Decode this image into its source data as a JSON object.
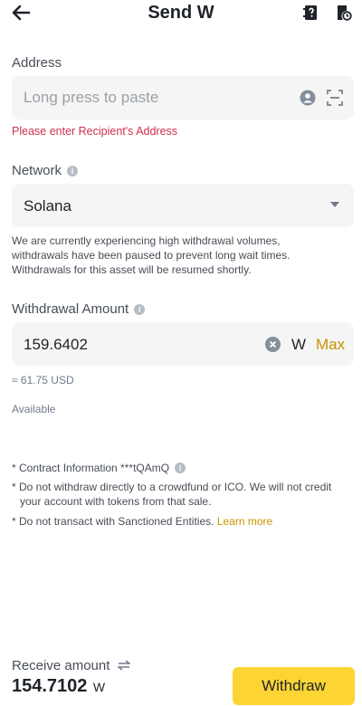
{
  "header": {
    "title": "Send W"
  },
  "address": {
    "label": "Address",
    "placeholder": "Long press to paste",
    "error": "Please enter Recipient's Address"
  },
  "network": {
    "label": "Network",
    "value": "Solana",
    "notice": "We are currently experiencing high withdrawal volumes, withdrawals have been paused to prevent long wait times. Withdrawals for this asset will be resumed shortly."
  },
  "amount": {
    "label": "Withdrawal Amount",
    "value": "159.6402",
    "unit": "W",
    "max_label": "Max",
    "usd_value": "≈ 61.75 USD",
    "available_label": "Available"
  },
  "info": {
    "contract": "* Contract Information ***tQAmQ",
    "crowdfund": "* Do not withdraw directly to a crowdfund or ICO. We will not credit your account with tokens from that sale.",
    "sanctioned": "* Do not transact with Sanctioned Entities.",
    "learn_more": "Learn more"
  },
  "footer": {
    "receive_label": "Receive amount",
    "receive_value": "154.7102",
    "receive_unit": "W",
    "withdraw_label": "Withdraw"
  },
  "colors": {
    "accent": "#fcd535",
    "error": "#cf304a",
    "link": "#c99400"
  },
  "icons": [
    "back-arrow-icon",
    "address-book-icon",
    "history-icon",
    "user-circle-icon",
    "scan-icon",
    "info-icon",
    "dropdown-arrow-icon",
    "clear-icon",
    "swap-icon"
  ]
}
